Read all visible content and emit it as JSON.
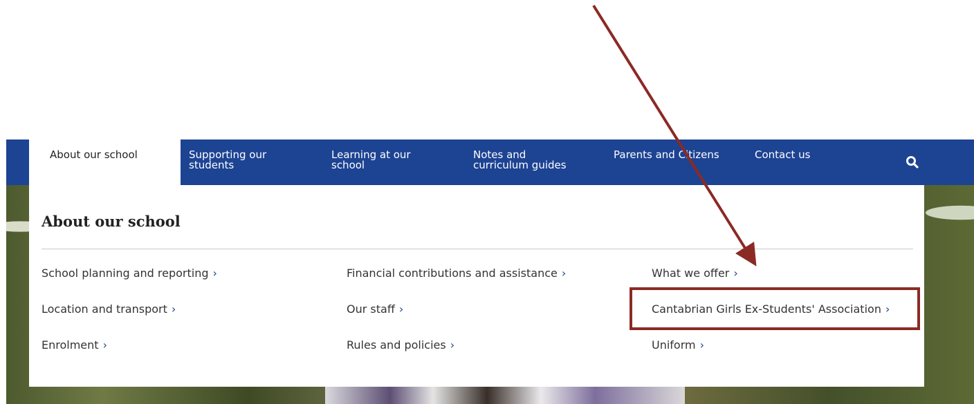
{
  "nav": {
    "items": [
      {
        "label": "About our school",
        "active": true
      },
      {
        "label": "Supporting our\nstudents",
        "active": false
      },
      {
        "label": "Learning at our\nschool",
        "active": false
      },
      {
        "label": "Notes and\ncurriculum guides",
        "active": false
      },
      {
        "label": "Parents and Citizens",
        "active": false
      },
      {
        "label": "Contact us",
        "active": false
      }
    ],
    "search_icon": "search-icon"
  },
  "dropdown": {
    "title": "About our school",
    "chevron": "›",
    "columns": [
      [
        "School planning and reporting",
        "Location and transport",
        "Enrolment"
      ],
      [
        "Financial contributions and assistance",
        "Our staff",
        "Rules and policies"
      ],
      [
        "What we offer",
        "Cantabrian Girls Ex-Students' Association",
        "Uniform"
      ]
    ]
  },
  "colors": {
    "nav_bg": "#1d4393",
    "annotation": "#8b2a24",
    "chevron": "#1d4393"
  }
}
